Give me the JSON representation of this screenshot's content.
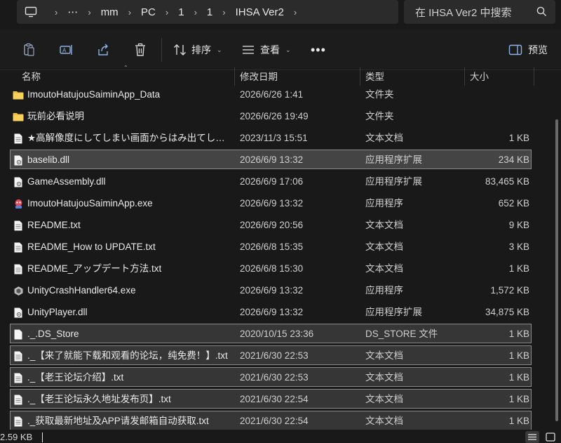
{
  "address": {
    "crumbs": [
      "⋯",
      "mm",
      "PC",
      "1",
      "1",
      "IHSA Ver2"
    ],
    "search_placeholder": "在 IHSA Ver2 中搜索"
  },
  "toolbar": {
    "sort_label": "排序",
    "view_label": "查看",
    "preview_label": "预览"
  },
  "columns": {
    "name": "名称",
    "date": "修改日期",
    "type": "类型",
    "size": "大小"
  },
  "files": [
    {
      "icon": "folder-icon",
      "name": "ImoutoHatujouSaiminApp_Data",
      "date": "2026/6/26 1:41",
      "type": "文件夹",
      "size": "",
      "state": ""
    },
    {
      "icon": "folder-icon",
      "name": "玩前必看说明",
      "date": "2026/6/26 19:49",
      "type": "文件夹",
      "size": "",
      "state": ""
    },
    {
      "icon": "text-file-icon",
      "name": "★高解像度にしてしまい画面からはみ出てしま...",
      "date": "2023/11/3 15:51",
      "type": "文本文档",
      "size": "1 KB",
      "state": ""
    },
    {
      "icon": "dll-file-icon",
      "name": "baselib.dll",
      "date": "2026/6/9 13:32",
      "type": "应用程序扩展",
      "size": "234 KB",
      "state": "sel"
    },
    {
      "icon": "dll-file-icon",
      "name": "GameAssembly.dll",
      "date": "2026/6/9 17:06",
      "type": "应用程序扩展",
      "size": "83,465 KB",
      "state": ""
    },
    {
      "icon": "app-exe-icon",
      "name": "ImoutoHatujouSaiminApp.exe",
      "date": "2026/6/9 13:32",
      "type": "应用程序",
      "size": "652 KB",
      "state": ""
    },
    {
      "icon": "text-file-icon",
      "name": "README.txt",
      "date": "2026/6/9 20:56",
      "type": "文本文档",
      "size": "9 KB",
      "state": ""
    },
    {
      "icon": "text-file-icon",
      "name": "README_How to UPDATE.txt",
      "date": "2026/6/8 15:35",
      "type": "文本文档",
      "size": "3 KB",
      "state": ""
    },
    {
      "icon": "text-file-icon",
      "name": "README_アップデート方法.txt",
      "date": "2026/6/8 15:30",
      "type": "文本文档",
      "size": "1 KB",
      "state": ""
    },
    {
      "icon": "unity-crash-icon",
      "name": "UnityCrashHandler64.exe",
      "date": "2026/6/9 13:32",
      "type": "应用程序",
      "size": "1,572 KB",
      "state": ""
    },
    {
      "icon": "dll-file-icon",
      "name": "UnityPlayer.dll",
      "date": "2026/6/9 13:32",
      "type": "应用程序扩展",
      "size": "34,875 KB",
      "state": ""
    },
    {
      "icon": "blank-file-icon",
      "name": "._.DS_Store",
      "date": "2020/10/15 23:36",
      "type": "DS_STORE 文件",
      "size": "1 KB",
      "state": "sel2"
    },
    {
      "icon": "text-file-icon",
      "name": "._【来了就能下载和观看的论坛，纯免费！】.txt",
      "date": "2021/6/30 22:53",
      "type": "文本文档",
      "size": "1 KB",
      "state": "sel2"
    },
    {
      "icon": "text-file-icon",
      "name": "._【老王论坛介绍】.txt",
      "date": "2021/6/30 22:53",
      "type": "文本文档",
      "size": "1 KB",
      "state": "sel2"
    },
    {
      "icon": "text-file-icon",
      "name": "._【老王论坛永久地址发布页】.txt",
      "date": "2021/6/30 22:54",
      "type": "文本文档",
      "size": "1 KB",
      "state": "sel2"
    },
    {
      "icon": "text-file-icon",
      "name": "._获取最新地址及APP请发邮箱自动获取.txt",
      "date": "2021/6/30 22:54",
      "type": "文本文档",
      "size": "1 KB",
      "state": "sel2"
    }
  ],
  "status": {
    "selection_size": "2.59 KB"
  }
}
